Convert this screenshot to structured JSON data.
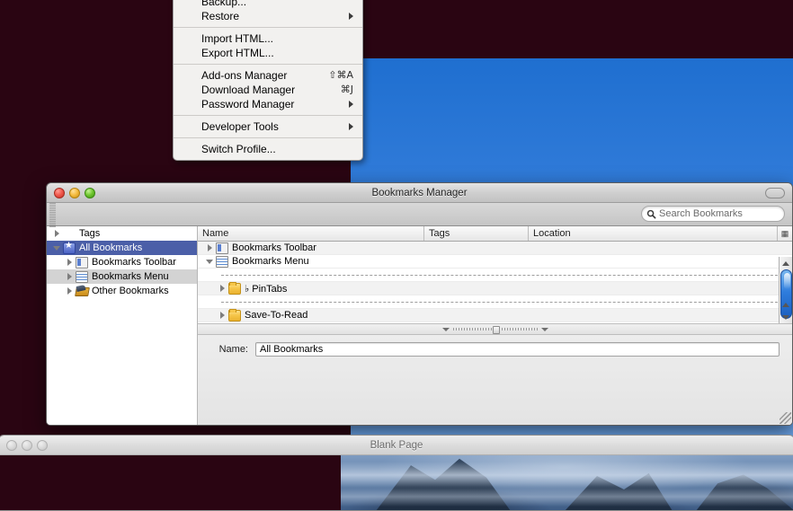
{
  "desktop": {
    "background_color": "#2a0512",
    "sky_color": "#2f7ad8"
  },
  "menu": {
    "name": "bookmarks-tools-menu",
    "groups": [
      {
        "items": [
          {
            "label": "Backup...",
            "shortcut": "",
            "submenu": false
          },
          {
            "label": "Restore",
            "shortcut": "",
            "submenu": true
          }
        ]
      },
      {
        "items": [
          {
            "label": "Import HTML...",
            "shortcut": "",
            "submenu": false
          },
          {
            "label": "Export HTML...",
            "shortcut": "",
            "submenu": false
          }
        ]
      },
      {
        "items": [
          {
            "label": "Add-ons Manager",
            "shortcut": "⇧⌘A",
            "submenu": false
          },
          {
            "label": "Download Manager",
            "shortcut": "⌘J",
            "submenu": false
          },
          {
            "label": "Password Manager",
            "shortcut": "",
            "submenu": true
          }
        ]
      },
      {
        "items": [
          {
            "label": "Developer Tools",
            "shortcut": "",
            "submenu": true
          }
        ]
      },
      {
        "items": [
          {
            "label": "Switch Profile...",
            "shortcut": "",
            "submenu": false
          }
        ]
      }
    ]
  },
  "bookmarks_window": {
    "title": "Bookmarks Manager",
    "search": {
      "placeholder": "Search Bookmarks",
      "value": "",
      "icon": "search-icon"
    },
    "sidebar": {
      "items": [
        {
          "label": "Tags",
          "icon": "none",
          "depth": 0,
          "twisty": "closed",
          "state": "normal"
        },
        {
          "label": "All Bookmarks",
          "icon": "star-icon",
          "depth": 0,
          "twisty": "open",
          "state": "selected"
        },
        {
          "label": "Bookmarks Toolbar",
          "icon": "toolbar-icon",
          "depth": 1,
          "twisty": "closed",
          "state": "normal"
        },
        {
          "label": "Bookmarks Menu",
          "icon": "menu-list-icon",
          "depth": 1,
          "twisty": "closed",
          "state": "highlighted"
        },
        {
          "label": "Other Bookmarks",
          "icon": "other-bookmarks-icon",
          "depth": 1,
          "twisty": "closed",
          "state": "normal"
        }
      ]
    },
    "columns": [
      {
        "label": "Name",
        "key": "name"
      },
      {
        "label": "Tags",
        "key": "tags"
      },
      {
        "label": "Location",
        "key": "location"
      }
    ],
    "column_picker_icon": "column-options-icon",
    "rows": [
      {
        "type": "item",
        "label": "Bookmarks Toolbar",
        "icon": "toolbar-icon",
        "depth": 0,
        "twisty": "closed",
        "tags": "",
        "location": ""
      },
      {
        "type": "item",
        "label": "Bookmarks Menu",
        "icon": "menu-list-icon",
        "depth": 0,
        "twisty": "open",
        "tags": "",
        "location": ""
      },
      {
        "type": "drop-indicator",
        "label": "",
        "icon": "",
        "depth": 1,
        "twisty": "",
        "tags": "",
        "location": ""
      },
      {
        "type": "item",
        "label": "♭ PinTabs",
        "icon": "folder-icon",
        "depth": 1,
        "twisty": "closed",
        "tags": "",
        "location": ""
      },
      {
        "type": "drop-indicator",
        "label": "",
        "icon": "",
        "depth": 1,
        "twisty": "",
        "tags": "",
        "location": ""
      },
      {
        "type": "item",
        "label": "Save-To-Read",
        "icon": "folder-icon",
        "depth": 1,
        "twisty": "closed",
        "tags": "",
        "location": ""
      }
    ],
    "scrollbar": {
      "up_icon": "scroll-up-arrow",
      "down_icon": "scroll-down-arrow"
    },
    "detail": {
      "name_label": "Name:",
      "name_value": "All Bookmarks"
    },
    "window_buttons": {
      "close": "close-button",
      "minimize": "minimize-button",
      "zoom": "zoom-button"
    },
    "toolbar_toggle": "toolbar-toggle-button"
  },
  "background_window": {
    "title": "Blank Page"
  }
}
